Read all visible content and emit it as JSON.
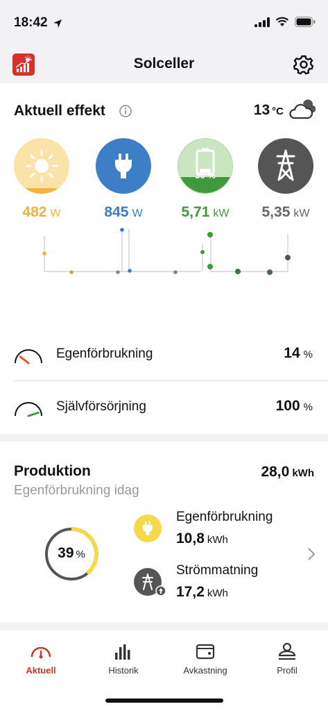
{
  "status": {
    "time": "18:42"
  },
  "nav": {
    "title": "Solceller"
  },
  "live": {
    "title": "Aktuell effekt",
    "temperature": "13",
    "temperature_unit": "°C",
    "battery_soc": "30 %",
    "battery_level": 0.3,
    "flows": {
      "solar": {
        "value": "482",
        "unit": "W",
        "color": "#f0b43a"
      },
      "consumption": {
        "value": "845",
        "unit": "W",
        "color": "#3b7dc4"
      },
      "battery": {
        "value": "5,71",
        "unit": "kW",
        "color": "#3f9a3c"
      },
      "grid": {
        "value": "5,35",
        "unit": "kW",
        "color": "#666666"
      }
    },
    "self_consumption": {
      "label": "Egenförbrukning",
      "value": "14",
      "unit": "%",
      "level": 0.14
    },
    "self_sufficiency": {
      "label": "Självförsörjning",
      "value": "100",
      "unit": "%",
      "level": 1.0
    }
  },
  "production": {
    "title": "Produktion",
    "total": "28,0",
    "total_unit": "kWh",
    "subtitle": "Egenförbrukning idag",
    "percent": "39",
    "percent_unit": "%",
    "percent_level": 0.39,
    "self": {
      "label": "Egenförbrukning",
      "value": "10,8",
      "unit": "kWh"
    },
    "export": {
      "label": "Strömmatning",
      "value": "17,2",
      "unit": "kWh"
    }
  },
  "tabs": [
    {
      "label": "Aktuell",
      "active": true
    },
    {
      "label": "Historik",
      "active": false
    },
    {
      "label": "Avkastning",
      "active": false
    },
    {
      "label": "Profil",
      "active": false
    }
  ]
}
